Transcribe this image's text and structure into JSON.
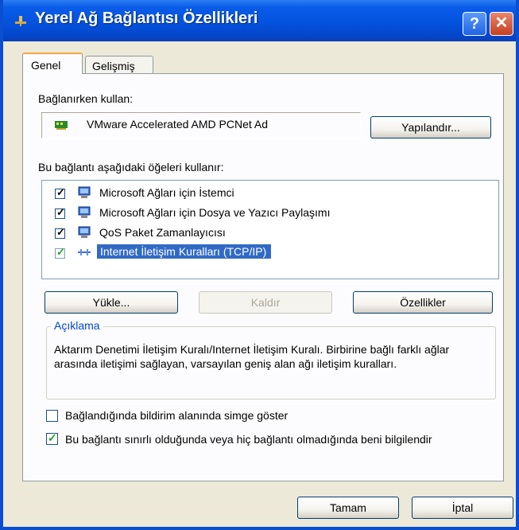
{
  "window": {
    "title": "Yerel Ağ Bağlantısı Özellikleri",
    "help_label": "?",
    "close_label": "✕"
  },
  "tabs": [
    {
      "label": "Genel",
      "active": true
    },
    {
      "label": "Gelişmiş",
      "active": false
    }
  ],
  "connect_using": {
    "label": "Bağlanırken kullan:",
    "adapter": "VMware Accelerated AMD PCNet Ad",
    "configure_button": "Yapılandır..."
  },
  "components": {
    "label": "Bu bağlantı aşağıdaki öğeleri kullanır:",
    "items": [
      {
        "label": "Microsoft Ağları için İstemci",
        "checked": true,
        "selected": false,
        "icon": "network-client-icon"
      },
      {
        "label": "Microsoft Ağları için Dosya ve Yazıcı Paylaşımı",
        "checked": true,
        "selected": false,
        "icon": "file-printer-sharing-icon"
      },
      {
        "label": "QoS Paket Zamanlayıcısı",
        "checked": true,
        "selected": false,
        "icon": "qos-scheduler-icon"
      },
      {
        "label": "Internet İletişim Kuralları (TCP/IP)",
        "checked": true,
        "selected": true,
        "icon": "protocol-icon"
      }
    ],
    "install_button": "Yükle...",
    "uninstall_button": "Kaldır",
    "properties_button": "Özellikler"
  },
  "description": {
    "title": "Açıklama",
    "text": "Aktarım Denetimi İletişim Kuralı/Internet İletişim Kuralı. Birbirine bağlı farklı ağlar arasında iletişimi sağlayan, varsayılan geniş alan ağı iletişim kuralları."
  },
  "options": [
    {
      "label": "Bağlandığında bildirim alanında simge göster",
      "checked": false
    },
    {
      "label": "Bu bağlantı sınırlı olduğunda veya hiç bağlantı olmadığında beni bilgilendir",
      "checked": true
    }
  ],
  "footer": {
    "ok_button": "Tamam",
    "cancel_button": "İptal"
  },
  "colors": {
    "titlebar": "#0454e0",
    "selection": "#316ac5",
    "legend": "#0046d5",
    "dialog_bg": "#ece9d8"
  }
}
